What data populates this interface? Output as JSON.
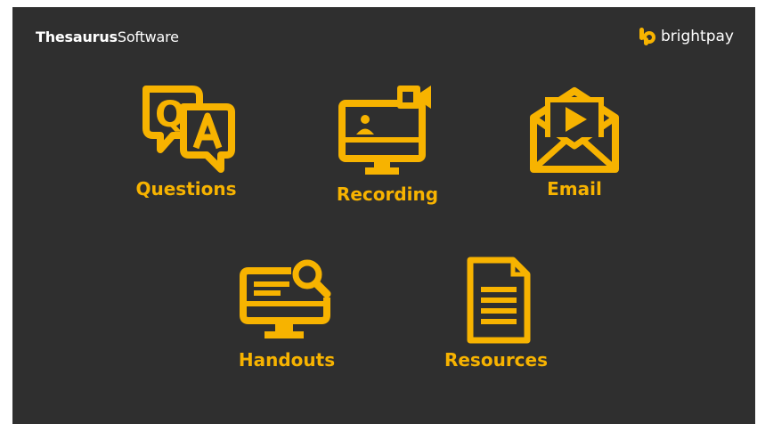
{
  "header": {
    "company_bold": "Thesaurus",
    "company_regular": "Software",
    "partner_logo_text": "brightpay"
  },
  "tiles": [
    {
      "label": "Questions",
      "icon": "qa-chat-icon"
    },
    {
      "label": "Recording",
      "icon": "video-monitor-icon"
    },
    {
      "label": "Email",
      "icon": "envelope-play-icon"
    },
    {
      "label": "Handouts",
      "icon": "monitor-search-icon"
    },
    {
      "label": "Resources",
      "icon": "document-icon"
    }
  ],
  "colors": {
    "background": "#2f2f2f",
    "accent": "#f7b300",
    "text": "#ffffff"
  }
}
